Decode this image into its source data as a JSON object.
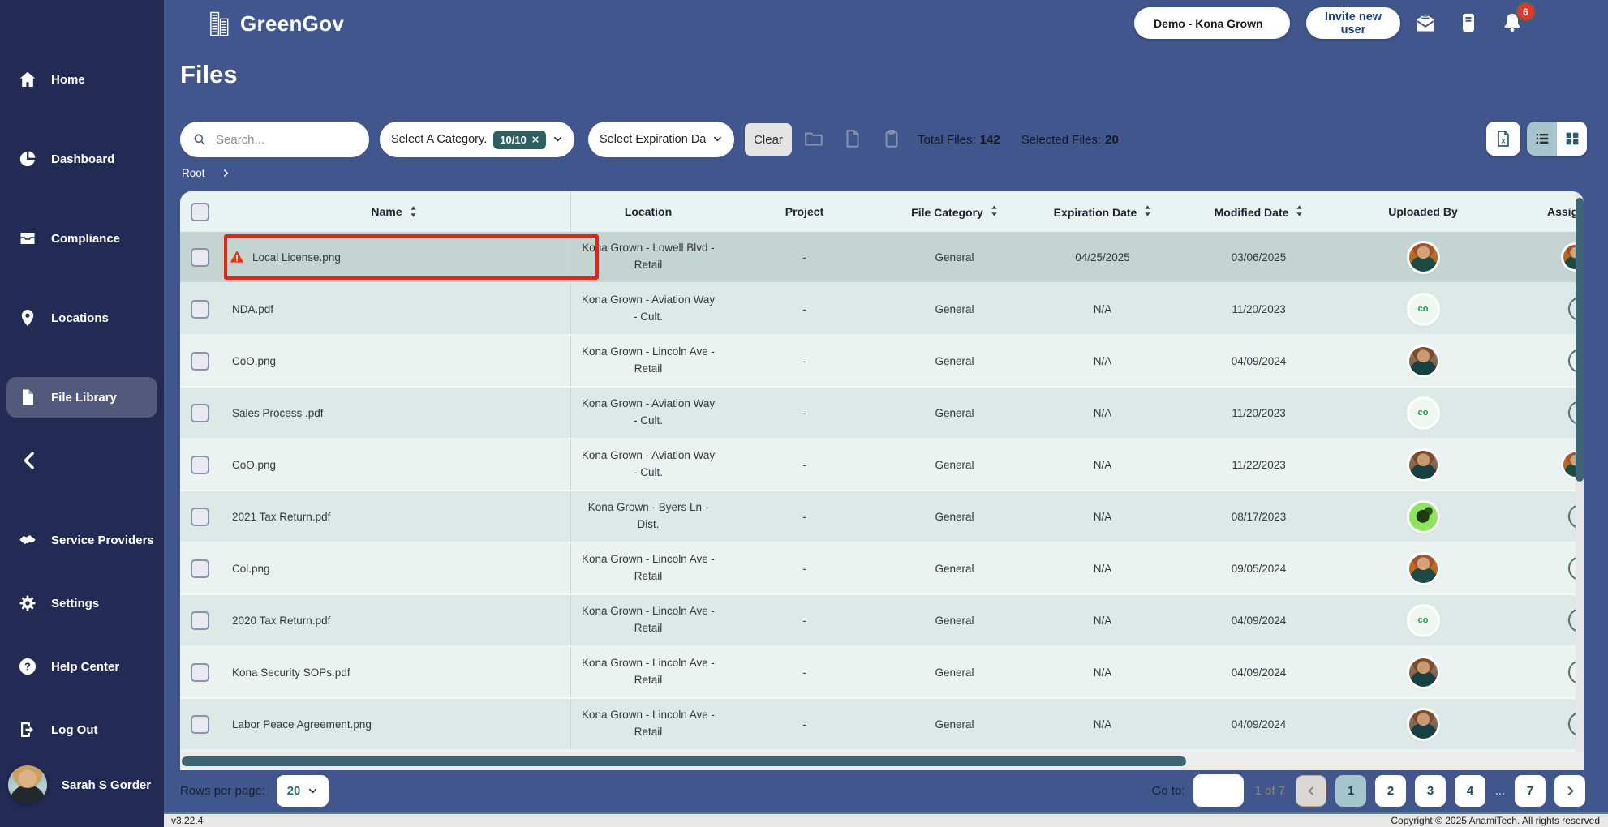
{
  "brand": {
    "name": "GreenGov",
    "logo_icon": "buildings-icon"
  },
  "header": {
    "org_selector": {
      "label": "Demo - Kona Grown",
      "icons": [
        "org-logo-icon",
        "close-icon",
        "chevron-down-icon"
      ]
    },
    "invite_label": "Invite new user",
    "icons": [
      "mail-icon",
      "document-icon",
      "bell-icon"
    ],
    "notification_count": "6"
  },
  "sidebar": {
    "main_items": [
      {
        "label": "Home",
        "icon": "home-icon",
        "active": false
      },
      {
        "label": "Dashboard",
        "icon": "dashboard-icon",
        "active": false
      },
      {
        "label": "Compliance",
        "icon": "compliance-icon",
        "active": false
      },
      {
        "label": "Locations",
        "icon": "locations-icon",
        "active": false
      },
      {
        "label": "File Library",
        "icon": "file-library-icon",
        "active": true
      }
    ],
    "secondary_items": [
      {
        "label": "Service Providers",
        "icon": "service-providers-icon",
        "active": false
      },
      {
        "label": "Settings",
        "icon": "settings-icon",
        "active": false
      },
      {
        "label": "Help Center",
        "icon": "help-center-icon",
        "active": false
      },
      {
        "label": "Log Out",
        "icon": "logout-icon",
        "active": false
      }
    ],
    "user": {
      "name": "Sarah S Gorder"
    }
  },
  "page": {
    "title": "Files",
    "search_placeholder": "Search...",
    "category_filter": {
      "label": "Select A Category...",
      "badge": "10/10"
    },
    "expiration_filter": {
      "label": "Select Expiration Date"
    },
    "clear_label": "Clear",
    "disabled_icons": [
      "folder-icon",
      "file-icon",
      "clipboard-icon"
    ],
    "totals": {
      "total_label": "Total Files:",
      "total_value": "142",
      "selected_label": "Selected Files:",
      "selected_value": "20"
    },
    "breadcrumb": "Root"
  },
  "table": {
    "headers": [
      {
        "label": "Name",
        "sortable": true
      },
      {
        "label": "Location",
        "sortable": false
      },
      {
        "label": "Project",
        "sortable": false
      },
      {
        "label": "File Category",
        "sortable": true
      },
      {
        "label": "Expiration Date",
        "sortable": true
      },
      {
        "label": "Modified Date",
        "sortable": true
      },
      {
        "label": "Uploaded By",
        "sortable": false
      },
      {
        "label": "Assig",
        "sortable": false
      }
    ],
    "rows": [
      {
        "name": "Local License.png",
        "warning": true,
        "selected": true,
        "location": "Kona Grown - Lowell Blvd - Retail",
        "project": "-",
        "category": "General",
        "expiration": "04/25/2025",
        "modified": "03/06/2025",
        "uploader": {
          "type": "photo-a",
          "initials": ""
        },
        "assignee_peek": "avatar"
      },
      {
        "name": "NDA.pdf",
        "warning": false,
        "selected": false,
        "location": "Kona Grown - Aviation Way - Cult.",
        "project": "-",
        "category": "General",
        "expiration": "N/A",
        "modified": "11/20/2023",
        "uploader": {
          "type": "initials",
          "initials": "co"
        },
        "assignee_peek": "ring"
      },
      {
        "name": "CoO.png",
        "warning": false,
        "selected": false,
        "location": "Kona Grown - Lincoln Ave - Retail",
        "project": "-",
        "category": "General",
        "expiration": "N/A",
        "modified": "04/09/2024",
        "uploader": {
          "type": "photo-b",
          "initials": ""
        },
        "assignee_peek": "ring"
      },
      {
        "name": "Sales Process .pdf",
        "warning": false,
        "selected": false,
        "location": "Kona Grown - Aviation Way - Cult.",
        "project": "-",
        "category": "General",
        "expiration": "N/A",
        "modified": "11/20/2023",
        "uploader": {
          "type": "initials",
          "initials": "co"
        },
        "assignee_peek": "ring"
      },
      {
        "name": "CoO.png",
        "warning": false,
        "selected": false,
        "location": "Kona Grown - Aviation Way - Cult.",
        "project": "-",
        "category": "General",
        "expiration": "N/A",
        "modified": "11/22/2023",
        "uploader": {
          "type": "photo-b",
          "initials": ""
        },
        "assignee_peek": "avatar"
      },
      {
        "name": "2021 Tax Return.pdf",
        "warning": false,
        "selected": false,
        "location": "Kona Grown - Byers Ln - Dist.",
        "project": "-",
        "category": "General",
        "expiration": "N/A",
        "modified": "08/17/2023",
        "uploader": {
          "type": "plant",
          "initials": ""
        },
        "assignee_peek": "ring"
      },
      {
        "name": "Col.png",
        "warning": false,
        "selected": false,
        "location": "Kona Grown - Lincoln Ave - Retail",
        "project": "-",
        "category": "General",
        "expiration": "N/A",
        "modified": "09/05/2024",
        "uploader": {
          "type": "photo-a",
          "initials": ""
        },
        "assignee_peek": "ring"
      },
      {
        "name": "2020 Tax Return.pdf",
        "warning": false,
        "selected": false,
        "location": "Kona Grown - Lincoln Ave - Retail",
        "project": "-",
        "category": "General",
        "expiration": "N/A",
        "modified": "04/09/2024",
        "uploader": {
          "type": "initials",
          "initials": "co"
        },
        "assignee_peek": "ring"
      },
      {
        "name": "Kona Security SOPs.pdf",
        "warning": false,
        "selected": false,
        "location": "Kona Grown - Lincoln Ave - Retail",
        "project": "-",
        "category": "General",
        "expiration": "N/A",
        "modified": "04/09/2024",
        "uploader": {
          "type": "photo-b",
          "initials": ""
        },
        "assignee_peek": "ring"
      },
      {
        "name": "Labor Peace Agreement.png",
        "warning": false,
        "selected": false,
        "location": "Kona Grown - Lincoln Ave - Retail",
        "project": "-",
        "category": "General",
        "expiration": "N/A",
        "modified": "04/09/2024",
        "uploader": {
          "type": "photo-b",
          "initials": ""
        },
        "assignee_peek": "ring"
      }
    ]
  },
  "pagination": {
    "rows_per_page_label": "Rows per page:",
    "rows_per_page_value": "20",
    "goto_label": "Go to:",
    "page_info": "1 of 7",
    "pages": [
      "1",
      "2",
      "3",
      "4",
      "...",
      "7"
    ],
    "current_page": "1"
  },
  "footer": {
    "version": "v3.22.4",
    "copyright": "Copyright © 2025 AnamiTech. All rights reserved"
  },
  "colors": {
    "app_background": "#42568e",
    "sidebar_background": "#232b55",
    "accent_teal": "#3c6472",
    "category_badge": "#2d5f63",
    "selected_row": "#c3d4d1",
    "alert_red": "#e8230f",
    "notification_red": "#e0382c",
    "brand_green": "#2fa84f",
    "active_page": "#a6c4cc"
  }
}
